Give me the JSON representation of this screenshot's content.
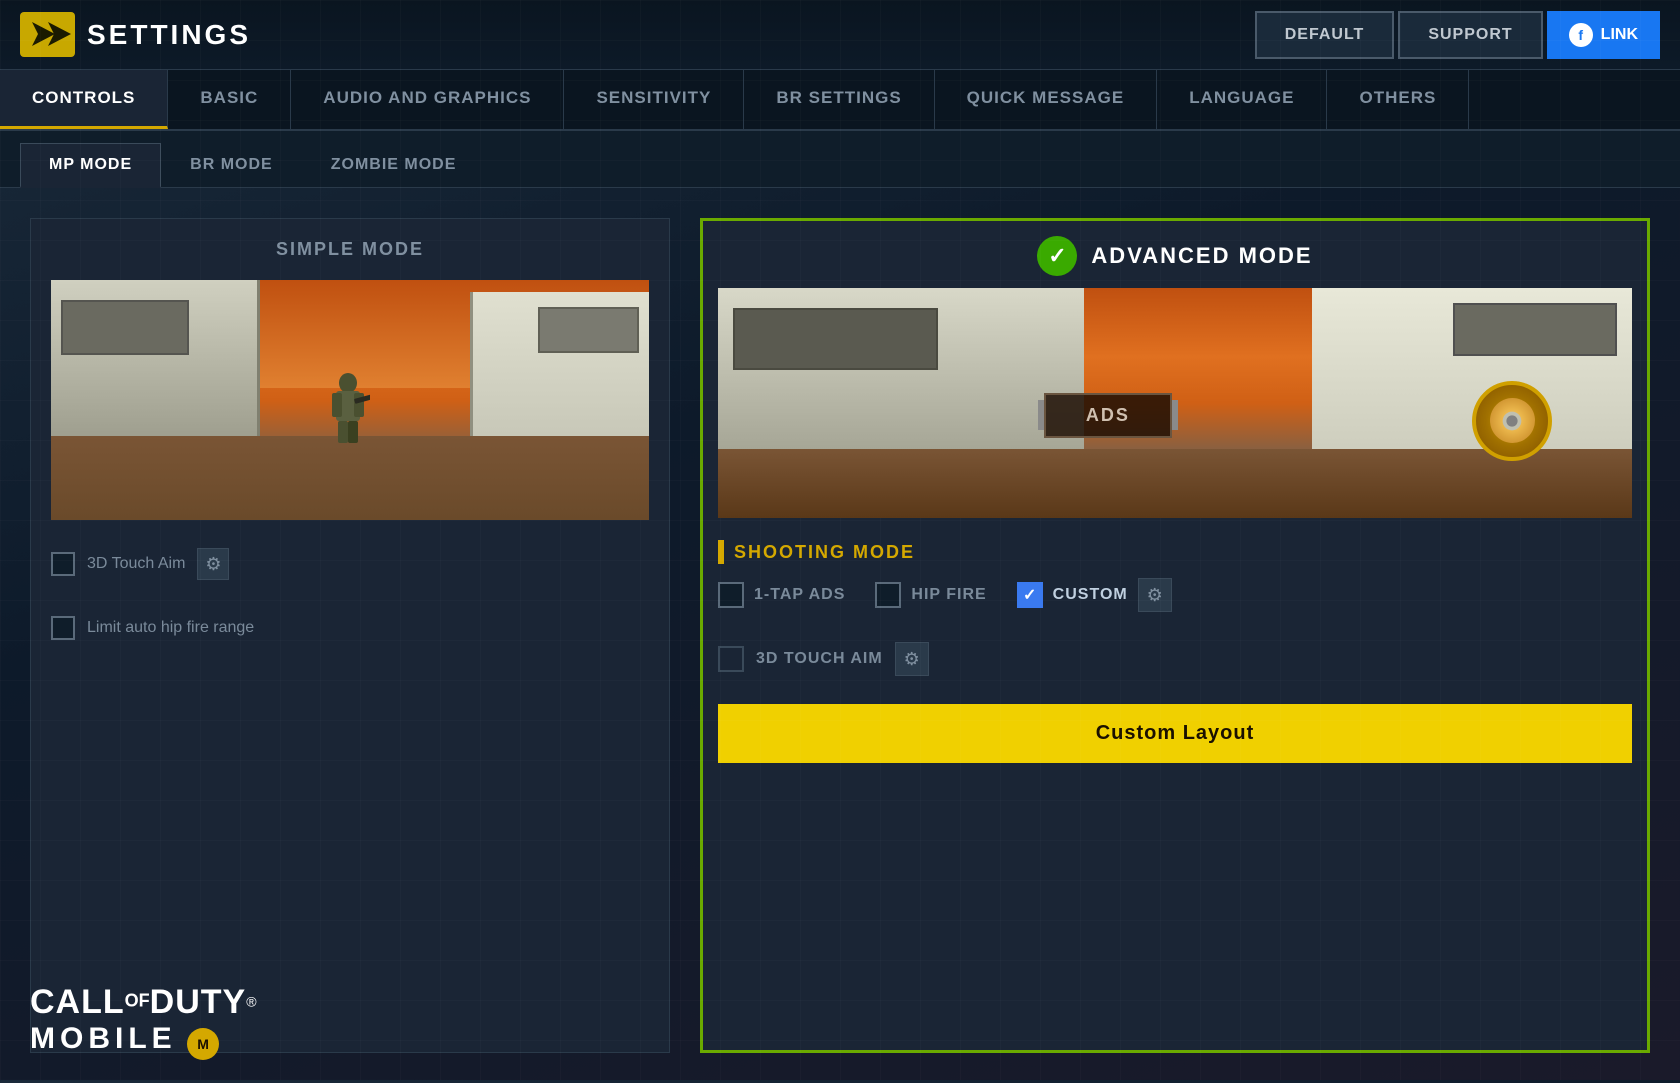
{
  "header": {
    "title": "SETTINGS",
    "buttons": {
      "default": "DEFAULT",
      "support": "SUPPORT",
      "fb_icon": "f",
      "link": "LINK"
    }
  },
  "main_tabs": [
    {
      "id": "controls",
      "label": "CONTROLS",
      "active": true
    },
    {
      "id": "basic",
      "label": "BASIC",
      "active": false
    },
    {
      "id": "audio_graphics",
      "label": "AUDIO AND GRAPHICS",
      "active": false
    },
    {
      "id": "sensitivity",
      "label": "SENSITIVITY",
      "active": false
    },
    {
      "id": "br_settings",
      "label": "BR SETTINGS",
      "active": false
    },
    {
      "id": "quick_message",
      "label": "QUICK MESSAGE",
      "active": false
    },
    {
      "id": "language",
      "label": "LANGUAGE",
      "active": false
    },
    {
      "id": "others",
      "label": "OTHERS",
      "active": false
    }
  ],
  "sub_tabs": [
    {
      "id": "mp_mode",
      "label": "MP MODE",
      "active": true
    },
    {
      "id": "br_mode",
      "label": "BR MODE",
      "active": false
    },
    {
      "id": "zombie_mode",
      "label": "ZOMBIE MODE",
      "active": false
    }
  ],
  "simple_mode": {
    "title": "SIMPLE MODE",
    "checkbox_3d_touch": {
      "label": "3D Touch Aim",
      "checked": false
    },
    "checkbox_limit": {
      "label": "Limit auto hip fire range",
      "checked": false
    }
  },
  "advanced_mode": {
    "title": "ADVANCED MODE",
    "check_icon": "✓",
    "ads_label": "ADS",
    "shooting_mode": {
      "title": "SHOOTING MODE",
      "options": [
        {
          "id": "one_tap_ads",
          "label": "1-tap ADS",
          "checked": false
        },
        {
          "id": "hip_fire",
          "label": "HIP FIRE",
          "checked": false
        },
        {
          "id": "custom",
          "label": "CUSTOM",
          "checked": true
        }
      ]
    },
    "touch_aim": {
      "label": "3D Touch Aim",
      "checked": false
    },
    "custom_layout_btn": "Custom Layout"
  },
  "cod_logo": {
    "call": "CALL",
    "of": "OF",
    "duty": "DUTY",
    "reg": "®",
    "mobile": "MOBILE"
  }
}
